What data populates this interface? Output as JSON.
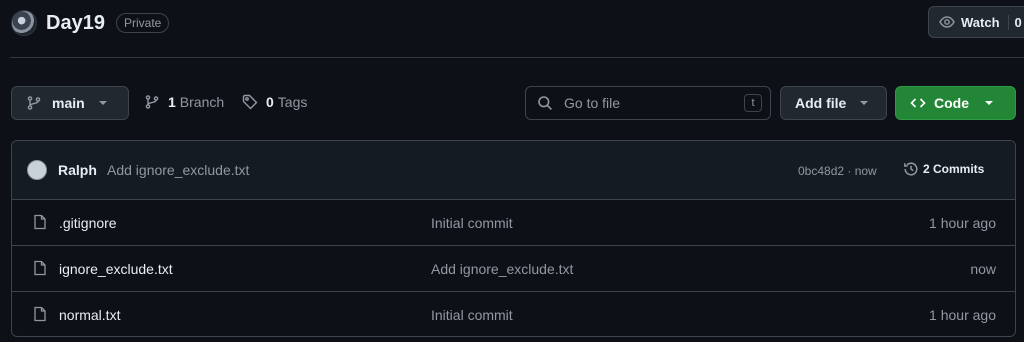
{
  "header": {
    "repo_name": "Day19",
    "visibility": "Private",
    "watch_label": "Watch",
    "watch_count": "0"
  },
  "toolbar": {
    "branch": "main",
    "branches_count": "1",
    "branches_label": "Branch",
    "tags_count": "0",
    "tags_label": "Tags",
    "search_placeholder": "Go to file",
    "search_shortcut": "t",
    "add_file_label": "Add file",
    "code_label": "Code"
  },
  "latest_commit": {
    "author": "Ralph",
    "message": "Add ignore_exclude.txt",
    "meta": "0bc48d2 · now",
    "commits_label": "2 Commits"
  },
  "files": [
    {
      "name": ".gitignore",
      "commit": "Initial commit",
      "age": "1 hour ago"
    },
    {
      "name": "ignore_exclude.txt",
      "commit": "Add ignore_exclude.txt",
      "age": "now"
    },
    {
      "name": "normal.txt",
      "commit": "Initial commit",
      "age": "1 hour ago"
    }
  ],
  "icons": {
    "branch": "git-branch-icon",
    "tag": "tag-icon",
    "search": "search-icon",
    "code": "code-icon",
    "history": "history-icon",
    "file": "file-icon",
    "eye": "eye-icon"
  },
  "colors": {
    "background": "#0d1117",
    "code_button": "#238636",
    "border": "#3d444d",
    "muted_text": "#9198a1"
  }
}
